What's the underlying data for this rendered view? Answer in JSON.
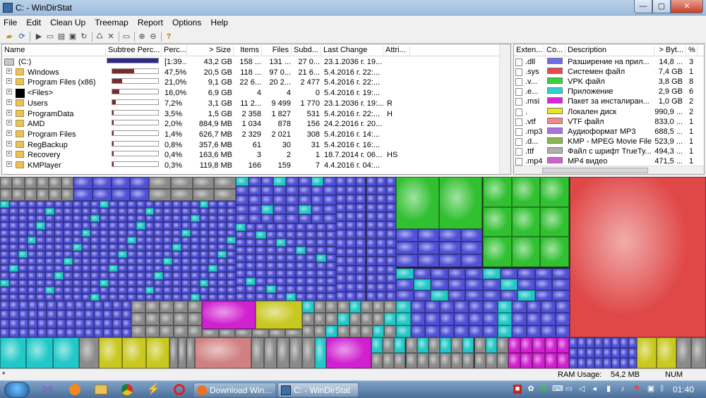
{
  "window": {
    "title": "C: - WinDirStat",
    "btn_min": "—",
    "btn_max": "▢",
    "btn_close": "✕"
  },
  "menu": [
    "File",
    "Edit",
    "Clean Up",
    "Treemap",
    "Report",
    "Options",
    "Help"
  ],
  "toolbar_icons": [
    "open-icon",
    "refresh-icon",
    "copy-path-icon",
    "explorer-icon",
    "cmd-icon",
    "play-icon",
    "refresh-selected-icon",
    "recycle-icon",
    "delete-icon",
    "folder-icon",
    "zoom-in-icon",
    "zoom-out-icon",
    "help-icon"
  ],
  "dirlist": {
    "headers": [
      "Name",
      "Subtree Perc...",
      "Perc...",
      "> Size",
      "Items",
      "Files",
      "Subd...",
      "Last Change",
      "Attri..."
    ],
    "rows": [
      {
        "name": "(C:)",
        "perc": "[1:39...",
        "size": "43,2 GB",
        "items": "158 ...",
        "files": "131 ...",
        "subd": "27 0...",
        "change": "23.1.2036 г. 19...",
        "attr": "",
        "fill": 1.0,
        "root": true
      },
      {
        "name": "Windows",
        "perc": "47,5%",
        "size": "20,5 GB",
        "items": "118 ...",
        "files": "97 0...",
        "subd": "21 6...",
        "change": "5.4.2016 г. 22:...",
        "attr": "",
        "fill": 0.475
      },
      {
        "name": "Program Files (x86)",
        "perc": "21,0%",
        "size": "9,1 GB",
        "items": "22 6...",
        "files": "20 2...",
        "subd": "2 477",
        "change": "5.4.2016 г. 22:...",
        "attr": "",
        "fill": 0.21
      },
      {
        "name": "<Files>",
        "perc": "16,0%",
        "size": "6,9 GB",
        "items": "4",
        "files": "4",
        "subd": "0",
        "change": "5.4.2016 г. 19:...",
        "attr": "",
        "fill": 0.16,
        "files_node": true
      },
      {
        "name": "Users",
        "perc": "7,2%",
        "size": "3,1 GB",
        "items": "11 2...",
        "files": "9 499",
        "subd": "1 770",
        "change": "23.1.2036 г. 19:...",
        "attr": "R",
        "fill": 0.072
      },
      {
        "name": "ProgramData",
        "perc": "3,5%",
        "size": "1,5 GB",
        "items": "2 358",
        "files": "1 827",
        "subd": "531",
        "change": "5.4.2016 г. 22:...",
        "attr": "H",
        "fill": 0.035
      },
      {
        "name": "AMD",
        "perc": "2,0%",
        "size": "884,9 MB",
        "items": "1 034",
        "files": "878",
        "subd": "156",
        "change": "24.2.2016 г. 20...",
        "attr": "",
        "fill": 0.02
      },
      {
        "name": "Program Files",
        "perc": "1,4%",
        "size": "626,7 MB",
        "items": "2 329",
        "files": "2 021",
        "subd": "308",
        "change": "5.4.2016 г. 14:...",
        "attr": "",
        "fill": 0.014
      },
      {
        "name": "RegBackup",
        "perc": "0,8%",
        "size": "357,6 MB",
        "items": "61",
        "files": "30",
        "subd": "31",
        "change": "5.4.2016 г. 16:...",
        "attr": "",
        "fill": 0.008
      },
      {
        "name": "Recovery",
        "perc": "0,4%",
        "size": "163,6 MB",
        "items": "3",
        "files": "2",
        "subd": "1",
        "change": "18.7.2014 г. 06...",
        "attr": "HS",
        "fill": 0.004
      },
      {
        "name": "KMPlayer",
        "perc": "0,3%",
        "size": "119,8 MB",
        "items": "166",
        "files": "159",
        "subd": "7",
        "change": "4.4.2016 г. 04:...",
        "attr": "",
        "fill": 0.003
      }
    ]
  },
  "extlist": {
    "headers": [
      "Exten...",
      "Co...",
      "Description",
      "> Byt...",
      "%"
    ],
    "rows": [
      {
        "ext": ".dll",
        "color": "#6f6fe8",
        "desc": "Разширение на прил...",
        "bytes": "14,8 ...",
        "pct": "3"
      },
      {
        "ext": ".sys",
        "color": "#e84a4a",
        "desc": "Системен файл",
        "bytes": "7,4 GB",
        "pct": "1"
      },
      {
        "ext": ".v...",
        "color": "#3ad03a",
        "desc": "VPK файл",
        "bytes": "3,8 GB",
        "pct": "8"
      },
      {
        "ext": ".e...",
        "color": "#2ad4d4",
        "desc": "Приложение",
        "bytes": "2,9 GB",
        "pct": "6"
      },
      {
        "ext": ".msi",
        "color": "#e020e0",
        "desc": "Пакет за инсталиран...",
        "bytes": "1,0 GB",
        "pct": "2"
      },
      {
        "ext": ".",
        "color": "#e8e820",
        "desc": "Локален диск",
        "bytes": "990,9 ...",
        "pct": "2"
      },
      {
        "ext": ".vtf",
        "color": "#f08a8a",
        "desc": "VTF файл",
        "bytes": "833,0 ...",
        "pct": "1"
      },
      {
        "ext": ".mp3",
        "color": "#b070e0",
        "desc": "Аудиоформат MP3",
        "bytes": "688,5 ...",
        "pct": "1"
      },
      {
        "ext": ".d...",
        "color": "#8ab84a",
        "desc": "KMP - MPEG Movie File",
        "bytes": "523,9 ...",
        "pct": "1"
      },
      {
        "ext": ".ttf",
        "color": "#b0b0b0",
        "desc": "Файл с шрифт TrueTy...",
        "bytes": "494,3 ...",
        "pct": "1"
      },
      {
        "ext": ".mp4",
        "color": "#d060d0",
        "desc": "MP4 видео",
        "bytes": "471,5 ...",
        "pct": "1"
      }
    ]
  },
  "status": {
    "marker": "*",
    "ram_label": "RAM Usage:",
    "ram_value": "54,2 MB",
    "num": "NUM"
  },
  "taskbar": {
    "apps": [
      "start-orb",
      "visual-studio-icon",
      "vlc-icon",
      "explorer-icon",
      "chrome-icon",
      "winamp-icon",
      "opera-icon"
    ],
    "buttons": [
      {
        "label": "Download Win..."
      },
      {
        "label": "C: - WinDirStat"
      }
    ],
    "clock": "01:40"
  },
  "colors": {
    "dll": "#5050d8",
    "sys": "#e04848",
    "vpk": "#30c030",
    "exe": "#20c8c8",
    "msi": "#d020d0",
    "grey": "#8a8a8a",
    "yellow": "#c8c820",
    "rose": "#d08080"
  }
}
